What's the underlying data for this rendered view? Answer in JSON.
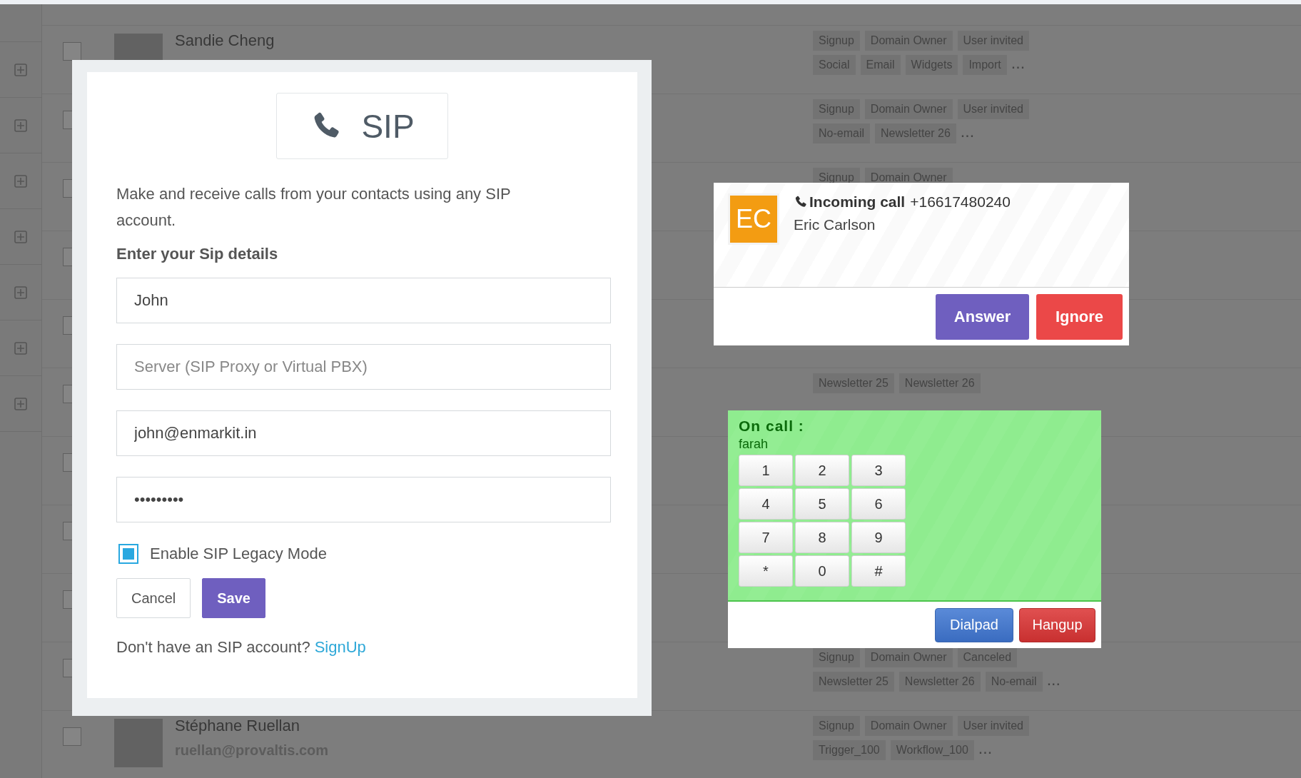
{
  "contacts": {
    "rows": [
      {
        "checked": false,
        "name": "Sandie Cheng",
        "tag_lines": [
          [
            "Signup",
            "Domain Owner",
            "User invited"
          ],
          [
            "Social",
            "Email",
            "Widgets",
            "Import"
          ]
        ],
        "more": "..."
      },
      {
        "checked": false,
        "tag_lines": [
          [
            "Signup",
            "Domain Owner",
            "User invited"
          ],
          [
            "No-email",
            "Newsletter 26"
          ]
        ],
        "more": "..."
      },
      {
        "checked": false,
        "tag_lines": [
          [
            "Signup",
            "Domain Owner"
          ]
        ]
      },
      {
        "checked": false
      },
      {
        "checked": false
      },
      {
        "checked": false,
        "tag_lines": [
          [
            "Newsletter 25",
            "Newsletter 26"
          ]
        ]
      },
      {
        "checked": false
      },
      {
        "checked": false
      },
      {
        "checked": false
      },
      {
        "checked": false,
        "tag_lines": [
          [
            "Signup",
            "Domain Owner",
            "Canceled"
          ],
          [
            "Newsletter 25",
            "Newsletter 26",
            "No-email"
          ]
        ],
        "more": "..."
      },
      {
        "checked": false,
        "name": "Stéphane Ruellan",
        "email": "ruellan@provaltis.com",
        "tag_lines": [
          [
            "Signup",
            "Domain Owner",
            "User invited"
          ],
          [
            "Trigger_100",
            "Workflow_100"
          ]
        ],
        "more": "..."
      }
    ]
  },
  "sip_dialog": {
    "title": "SIP",
    "description": "Make and receive calls from your contacts using any SIP account.",
    "heading": "Enter your Sip details",
    "fields": [
      {
        "value": "John"
      },
      {
        "placeholder": "Server (SIP Proxy or Virtual PBX)"
      },
      {
        "value": "john@enmarkit.in"
      },
      {
        "value": "•••••••••"
      }
    ],
    "legacy_mode": {
      "label": "Enable SIP Legacy Mode",
      "checked": true
    },
    "buttons": [
      {
        "label": "Cancel",
        "kind": "default"
      },
      {
        "label": "Save",
        "kind": "primary"
      }
    ],
    "footer": {
      "text": "Don't have an SIP account?",
      "link": "SignUp"
    }
  },
  "incoming_call": {
    "initials": "EC",
    "title": "Incoming call",
    "number": "+16617480240",
    "caller": "Eric Carlson",
    "buttons": [
      {
        "label": "Answer",
        "kind": "answer"
      },
      {
        "label": "Ignore",
        "kind": "ignore"
      }
    ]
  },
  "on_call": {
    "title": "On call :",
    "contact": "farah",
    "keys": [
      "1",
      "2",
      "3",
      "4",
      "5",
      "6",
      "7",
      "8",
      "9",
      "*",
      "0",
      "#"
    ],
    "buttons": [
      {
        "label": "Dialpad",
        "kind": "dialpad"
      },
      {
        "label": "Hangup",
        "kind": "hangup"
      }
    ]
  }
}
